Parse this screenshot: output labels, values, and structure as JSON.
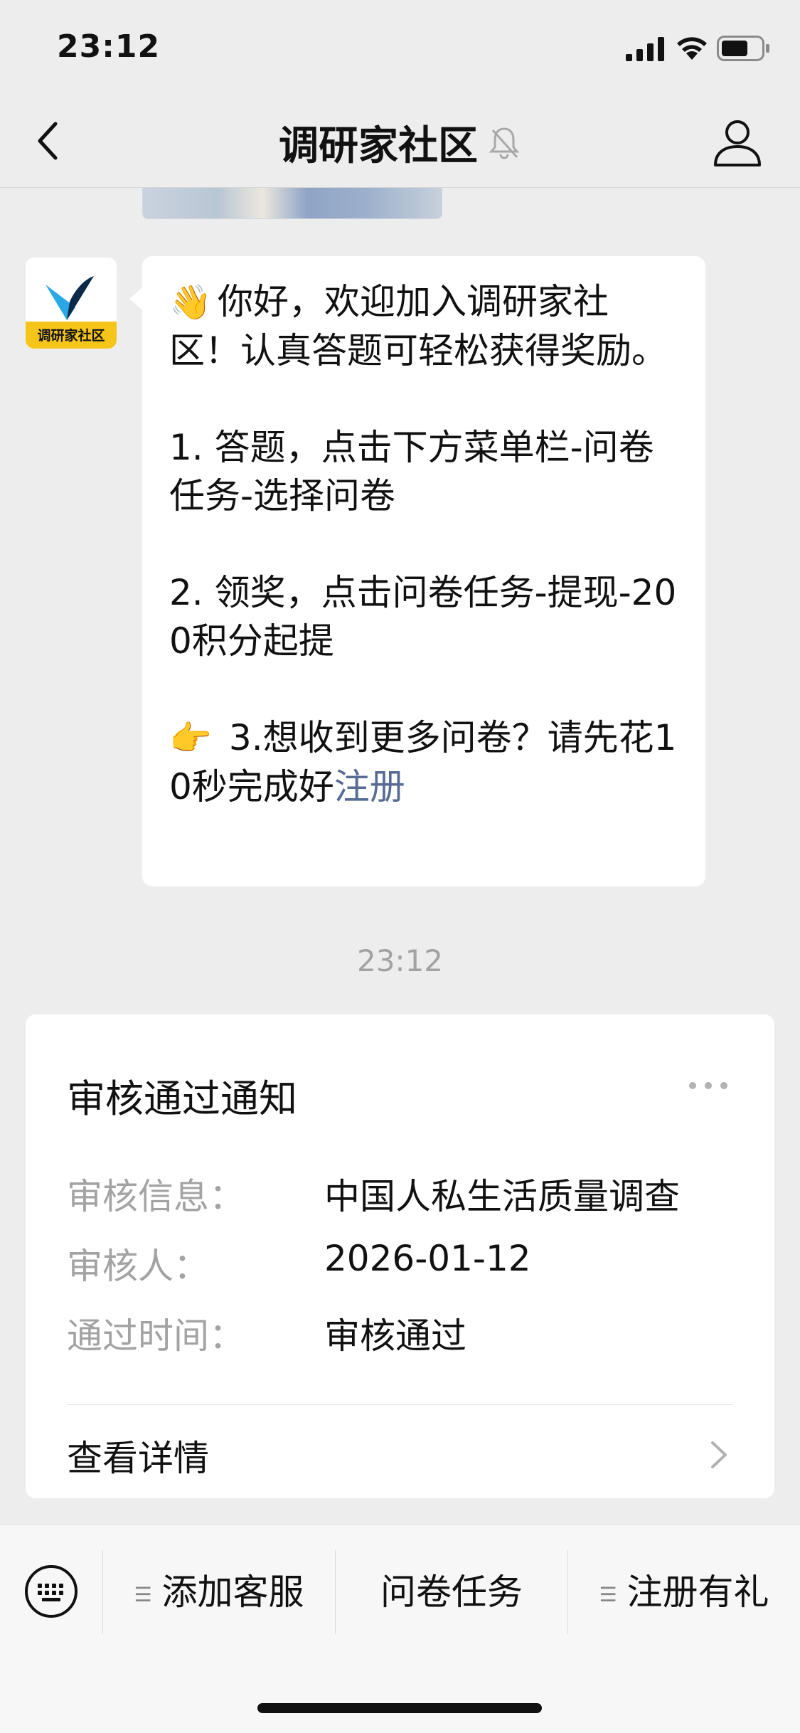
{
  "status_bar": {
    "time": "23:12"
  },
  "nav": {
    "title": "调研家社区"
  },
  "avatar": {
    "logo_text": "调研家社区"
  },
  "message": {
    "paragraphs": [
      {
        "emoji": "👋",
        "text": "你好，欢迎加入调研家社区！认真答题可轻松获得奖励。"
      },
      {
        "text": "1. 答题，点击下方菜单栏-问卷任务-选择问卷"
      },
      {
        "text": "2. 领奖，点击问卷任务-提现-200积分起提"
      },
      {
        "emoji": "👉",
        "text": " 3.想收到更多问卷？请先花10秒完成好",
        "link": "注册"
      }
    ]
  },
  "timestamp": "23:12",
  "card": {
    "title": "审核通过通知",
    "rows": [
      {
        "label": "审核信息：",
        "value": "中国人私生活质量调查"
      },
      {
        "label": "审核人：",
        "value": "2026-01-12"
      },
      {
        "label": "通过时间：",
        "value": "审核通过"
      }
    ],
    "detail_label": "查看详情"
  },
  "menu": {
    "items": [
      {
        "label": "添加客服",
        "has_submenu": true
      },
      {
        "label": "问卷任务",
        "has_submenu": false
      },
      {
        "label": "注册有礼",
        "has_submenu": true
      }
    ]
  },
  "colors": {
    "background": "#ededed",
    "bubble": "#ffffff",
    "link": "#576b95",
    "muted_text": "#a3a3a3",
    "logo_yellow": "#f5c51a",
    "logo_blue": "#1a6fd0",
    "logo_navy": "#0b2a4a"
  },
  "icons": {
    "back": "chevron-left-icon",
    "mute": "bell-slash-icon",
    "profile": "person-icon",
    "more": "ellipsis-icon",
    "keyboard": "keyboard-icon",
    "detail": "chevron-right-icon"
  }
}
